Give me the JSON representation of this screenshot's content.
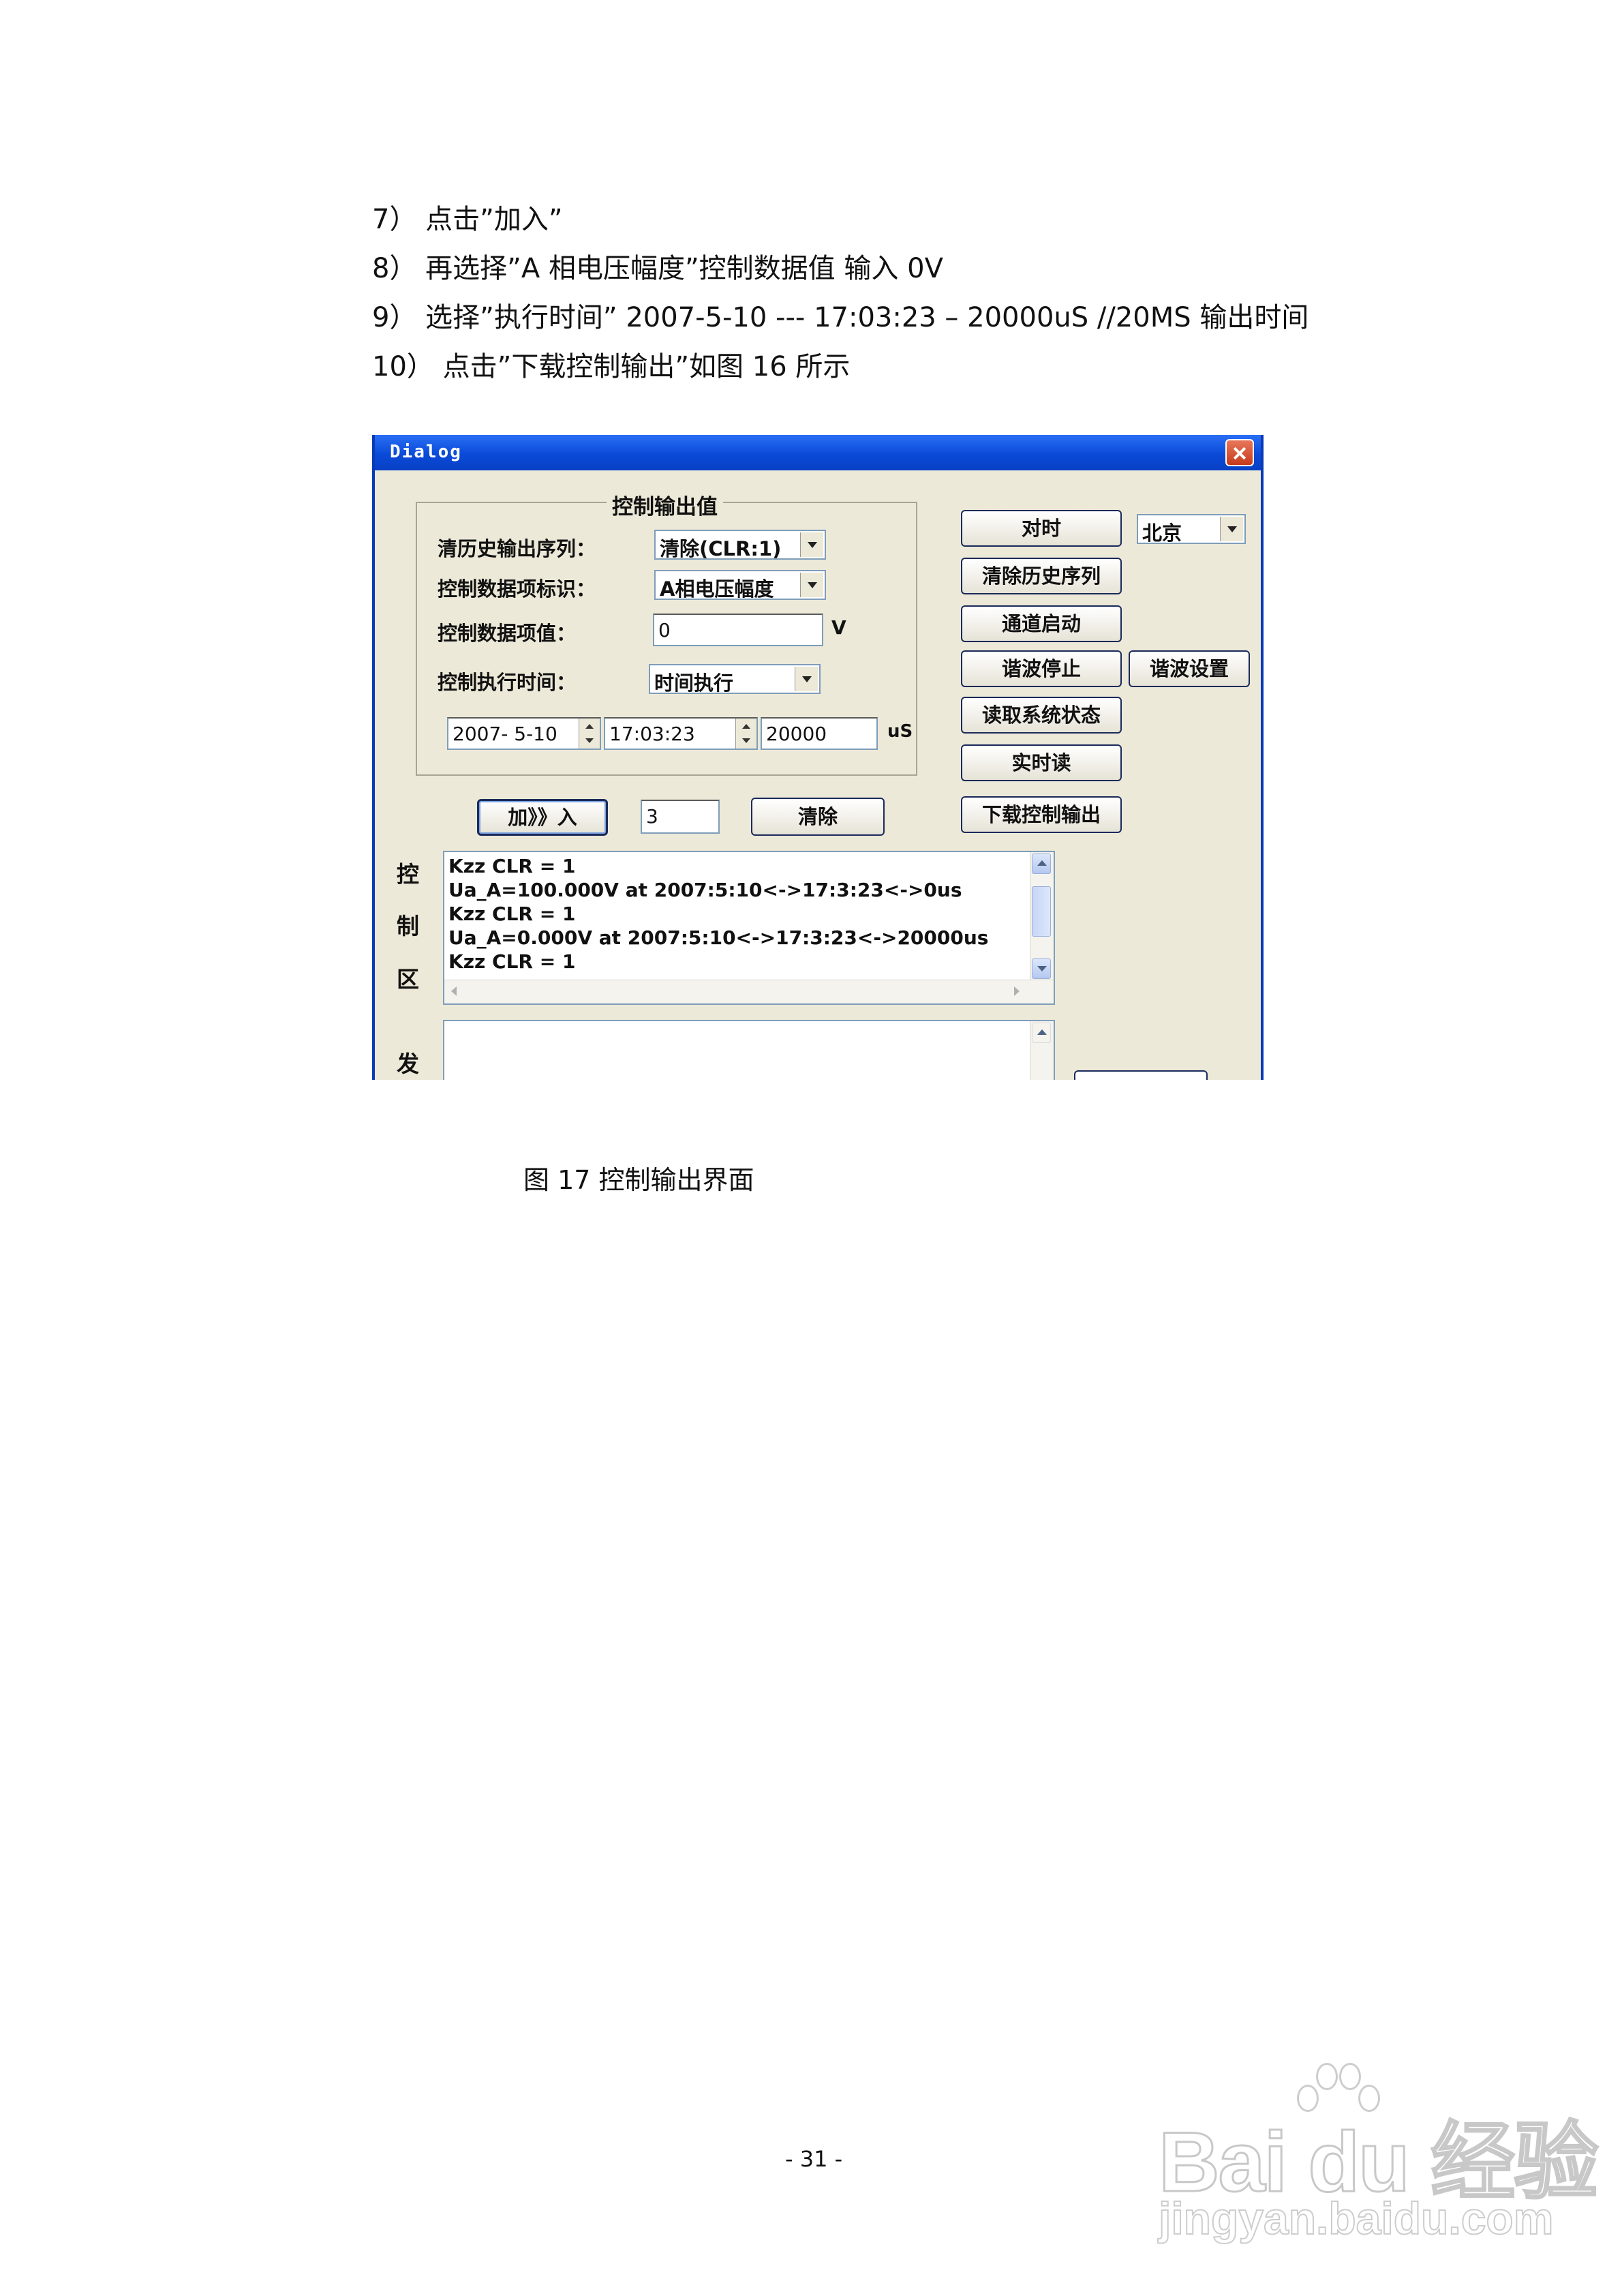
{
  "steps": [
    "7） 点击”加入”",
    "8） 再选择”A 相电压幅度”控制数据值  输入    0V",
    "9） 选择”执行时间” 2007-5-10 --- 17:03:23 – 20000uS //20MS 输出时间",
    "10）   点击”下载控制输出”如图 16 所示"
  ],
  "dialog": {
    "title": "Dialog",
    "group_title": "控制输出值",
    "labels": {
      "clear_history": "清历史输出序列：",
      "data_item_id": "控制数据项标识：",
      "data_item_value": "控制数据项值：",
      "exec_time": "控制执行时间："
    },
    "combos": {
      "clear_history": "清除(CLR:1)",
      "data_item_id": "A相电压幅度",
      "exec_time": "时间执行",
      "timezone": "北京"
    },
    "fields": {
      "value": "0",
      "value_unit": "V",
      "date": "2007- 5-10",
      "time": "17:03:23",
      "microseconds": "20000",
      "us_unit": "uS",
      "count": "3"
    },
    "buttons": {
      "add": "加》》入",
      "clear": "清除",
      "sync_time": "对时",
      "clear_history_seq": "清除历史序列",
      "channel_start": "通道启动",
      "wave_stop": "谐波停止",
      "wave_setup": "谐波设置",
      "read_status": "读取系统状态",
      "realtime_read": "实时读",
      "download": "下载控制输出"
    },
    "control_area_label": [
      "控",
      "制",
      "区"
    ],
    "send_area_label": "发",
    "log_lines": [
      "Kzz CLR = 1",
      "Ua_A=100.000V at 2007:5:10<->17:3:23<->0us",
      "Kzz CLR = 1",
      "Ua_A=0.000V at 2007:5:10<->17:3:23<->20000us",
      "Kzz CLR = 1"
    ]
  },
  "caption": "图 17    控制输出界面",
  "page_number": "- 31 -",
  "watermark": {
    "brand": "Bai du 经验",
    "url": "jingyan.baidu.com"
  }
}
